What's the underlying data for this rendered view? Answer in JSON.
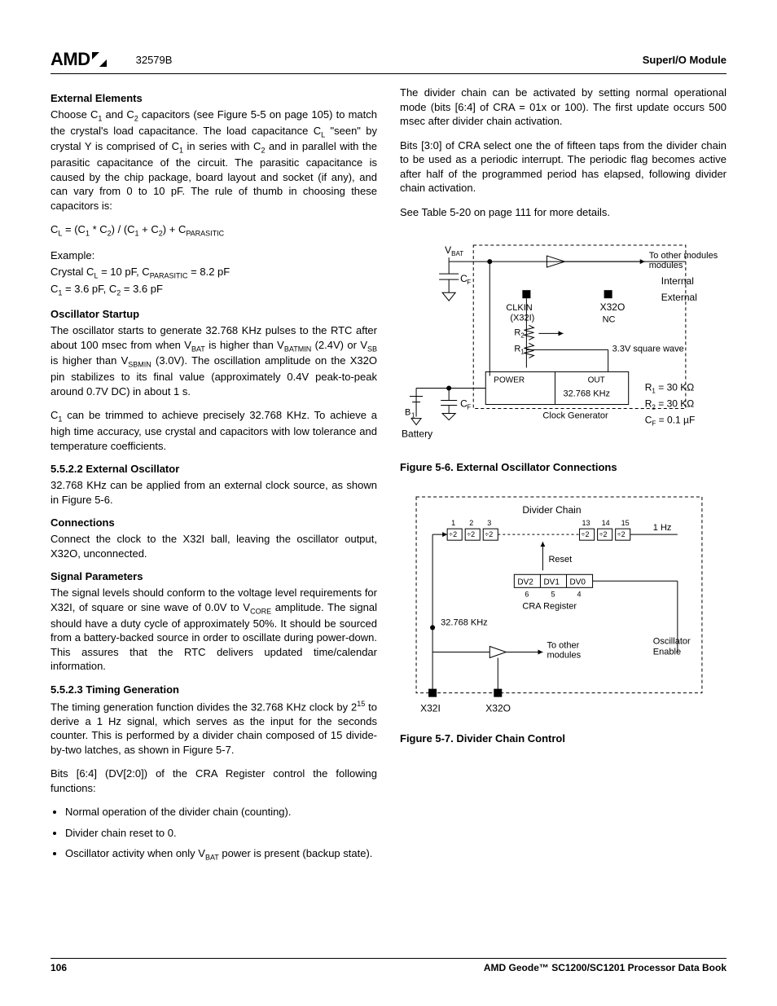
{
  "header": {
    "logo_text": "AMD",
    "docnum": "32579B",
    "module": "SuperI/O Module"
  },
  "left": {
    "h_ext_elems": "External Elements",
    "p_ext_elems": "Choose C₁ and C₂ capacitors (see Figure 5-5 on page 105) to match the crystal's load capacitance. The load capacitance C_L \"seen\" by crystal Y is comprised of C₁ in series with C₂ and in parallel with the parasitic capacitance of the circuit. The parasitic capacitance is caused by the chip package, board layout and socket (if any), and can vary from 0 to 10 pF. The rule of thumb in choosing these capacitors is:",
    "formula": "C_L = (C₁ * C₂) / (C₁ + C₂) + C_PARASITIC",
    "example_label": "Example:",
    "example_l1": "Crystal C_L = 10 pF, C_PARASITIC = 8.2 pF",
    "example_l2": "C₁ = 3.6 pF, C₂ = 3.6 pF",
    "h_osc_start": "Oscillator Startup",
    "p_osc_start": "The oscillator starts to generate 32.768 KHz pulses to the RTC after about 100 msec from when V_BAT is higher than V_BATMIN (2.4V) or V_SB is higher than V_SBMIN (3.0V). The oscillation amplitude on the X32O pin stabilizes to its final value (approximately 0.4V peak-to-peak around 0.7V DC) in about 1 s.",
    "p_osc_trim": "C₁ can be trimmed to achieve precisely 32.768 KHz. To achieve a high time accuracy, use crystal and capacitors with low tolerance and temperature coefficients.",
    "h_5522": "5.5.2.2    External Oscillator",
    "p_5522": "32.768 KHz can be applied from an external clock source, as shown in Figure 5-6.",
    "h_conn": "Connections",
    "p_conn": "Connect the clock to the X32I ball, leaving the oscillator output, X32O, unconnected.",
    "h_sig": "Signal Parameters",
    "p_sig": "The signal levels should conform to the voltage level requirements for X32I, of square or sine wave of 0.0V to V_CORE amplitude. The signal should have a duty cycle of approximately 50%. It should be sourced from a battery-backed source in order to oscillate during power-down. This assures that the RTC delivers updated time/calendar information.",
    "h_5523": "5.5.2.3    Timing Generation",
    "p_5523a": "The timing generation function divides the 32.768 KHz clock by 2¹⁵ to derive a 1 Hz signal, which serves as the input for the seconds counter. This is performed by a divider chain composed of 15 divide-by-two latches, as shown in Figure 5-7.",
    "p_5523b": "Bits [6:4] (DV[2:0]) of the CRA Register control the following functions:",
    "bullets": [
      "Normal operation of the divider chain (counting).",
      "Divider chain reset to 0.",
      "Oscillator activity when only V_BAT power is present (backup state)."
    ]
  },
  "right": {
    "p1": "The divider chain can be activated by setting normal operational mode (bits [6:4] of CRA = 01x or 100). The first update occurs 500 msec after divider chain activation.",
    "p2": "Bits [3:0] of CRA select one the of fifteen taps from the divider chain to be used as a periodic interrupt. The periodic flag becomes active after half of the programmed period has elapsed, following divider chain activation.",
    "p3": "See Table 5-20 on page 111 for more details.",
    "fig56_caption": "Figure 5-6.  External Oscillator Connections",
    "fig57_caption": "Figure 5-7.  Divider Chain Control",
    "fig56": {
      "vbat": "V_BAT",
      "to_other": "To other modules",
      "internal": "Internal",
      "external": "External",
      "cf": "C_F",
      "clkin": "CLKIN (X32I)",
      "x32o": "X32O",
      "nc": "NC",
      "r1": "R₁",
      "r2": "R₂",
      "sqwave": "3.3V square wave",
      "power": "POWER",
      "out": "OUT",
      "freq": "32.768 KHz",
      "clkgen": "Clock Generator",
      "b1": "B₁",
      "battery": "Battery",
      "r1v": "R₁ = 30 KΩ",
      "r2v": "R₂ = 30 KΩ",
      "cfv": "C_F = 0.1 µF"
    },
    "fig57": {
      "title": "Divider Chain",
      "nums_left": [
        "1",
        "2",
        "3"
      ],
      "nums_right": [
        "13",
        "14",
        "15"
      ],
      "div2": "÷2",
      "hz": "1 Hz",
      "reset": "Reset",
      "dv": [
        "DV2",
        "DV1",
        "DV0"
      ],
      "dv_idx": [
        "6",
        "5",
        "4"
      ],
      "cra": "CRA Register",
      "freq": "32.768 KHz",
      "to_other": "To other modules",
      "osc_en": "Oscillator Enable",
      "x32i": "X32I",
      "x32o": "X32O"
    }
  },
  "footer": {
    "page": "106",
    "book": "AMD Geode™ SC1200/SC1201 Processor Data Book"
  }
}
